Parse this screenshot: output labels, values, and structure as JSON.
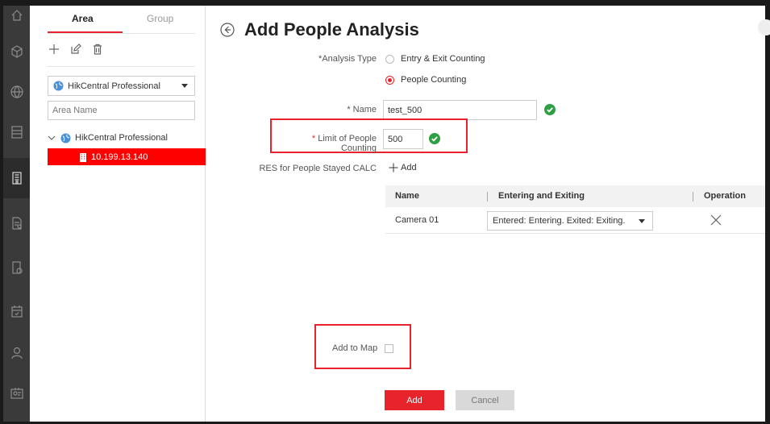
{
  "sidebar_rail": {
    "icons": [
      "home-icon",
      "cube-icon",
      "globe-icon",
      "server-icon",
      "building-icon",
      "report-icon",
      "device-icon",
      "calendar-icon",
      "person-icon",
      "badge-icon"
    ],
    "active": "building-icon"
  },
  "area_panel": {
    "tabs": [
      {
        "label": "Area"
      },
      {
        "label": "Group"
      }
    ],
    "active_tab": "Area",
    "toolbar": [
      "add-icon",
      "edit-icon",
      "delete-icon"
    ],
    "site_selector": "HikCentral Professional",
    "search_placeholder": "Area Name",
    "tree": {
      "root": "HikCentral Professional",
      "children": [
        {
          "label": "10.199.13.140",
          "selected": true
        }
      ]
    }
  },
  "main": {
    "title": "Add People Analysis",
    "analysis_type": {
      "label": "*Analysis Type",
      "options": [
        {
          "label": "Entry & Exit Counting",
          "checked": false
        },
        {
          "label": "People Counting",
          "checked": true
        }
      ]
    },
    "name": {
      "label": "* Name",
      "value": "test_500"
    },
    "limit": {
      "label": "* Limit of People Counting",
      "value": "500"
    },
    "res": {
      "label": "RES for People Stayed CALC",
      "add_label": "Add"
    },
    "table": {
      "headers": [
        "Name",
        "Entering and Exiting",
        "Operation"
      ],
      "rows": [
        {
          "name": "Camera 01",
          "mode": "Entered: Entering. Exited: Exiting."
        }
      ]
    },
    "add_to_map": {
      "label": "Add to Map",
      "checked": false
    },
    "buttons": {
      "add": "Add",
      "cancel": "Cancel"
    }
  },
  "colors": {
    "accent": "#e8232c",
    "selected_row": "#ff0000",
    "rail_bg": "#3a3a3a",
    "ok_green": "#2ea043"
  }
}
